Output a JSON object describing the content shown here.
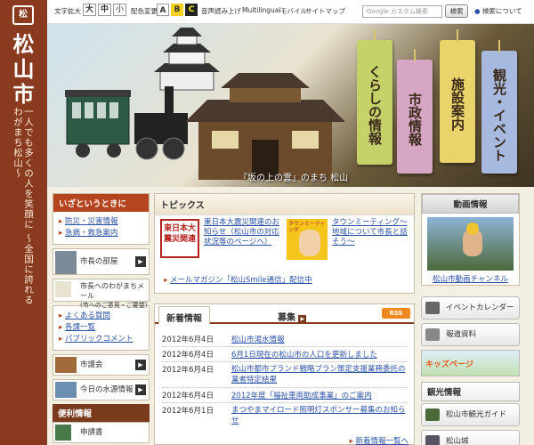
{
  "brand": {
    "logo_mark": "松",
    "city_name": "松山市",
    "slogan": "一人でも多くの人を笑顔に 〜全国に誇れるわがまち松山〜"
  },
  "topbar": {
    "text_size_label": "文字拡大",
    "size_large": "大",
    "size_medium": "中",
    "size_small": "小",
    "color_change_label": "配色変更",
    "color_a": "A",
    "color_b": "B",
    "color_c": "C",
    "speech_label": "音声読み上げ",
    "multilingual": "Multilingual",
    "mobile": "モバイル",
    "sitemap": "サイトマップ",
    "search_placeholder": "Google カスタム検索",
    "search_button": "検索",
    "search_about": "検索について"
  },
  "hero": {
    "caption": "『坂の上の雲』のまち 松山",
    "tags": [
      "くらしの情報",
      "市政情報",
      "施設案内",
      "観光・イベント"
    ],
    "tag_colors": [
      "#c5d26a",
      "#d7a6c4",
      "#e9d36b",
      "#a7b9de"
    ]
  },
  "left": {
    "emergency_header": "いざというときに",
    "emergency_links": [
      "防災・災害情報",
      "急病・救急案内"
    ],
    "mayor_room": "市長の部屋",
    "mayor_mail": "市長へのわがまちメール",
    "mayor_mail_sub": "(市へのご意見・ご要望)",
    "info_links": [
      "よくある質問",
      "各課一覧",
      "パブリックコメント"
    ],
    "assembly": "市議会",
    "water": "今日の水源情報",
    "convenience_header": "便利情報",
    "application": "申請書"
  },
  "topics": {
    "title": "トピックス",
    "banner1": "東日本大震災関連",
    "item1": "東日本大震災関連のお知らせ（松山市の対応状況等のページへ）",
    "banner2": "タウンミーティング",
    "item2": "タウンミーティング〜地域について市長と話そう〜",
    "mail_magazine": "メールマガジン「松山Smile通信」配信中"
  },
  "news": {
    "tab_new": "新着情報",
    "tab_recruit": "募集",
    "rss": "RSS",
    "items": [
      {
        "date": "2012年6月4日",
        "title": "松山市渇水情報"
      },
      {
        "date": "2012年6月4日",
        "title": "6月1日現在の松山市の人口を更新しました"
      },
      {
        "date": "2012年6月4日",
        "title": "松山市都市ブランド戦略プラン策定支援業務委託の業者特定結果"
      },
      {
        "date": "2012年6月4日",
        "title": "2012年度「福祉車両助成事業」のご案内"
      },
      {
        "date": "2012年6月1日",
        "title": "まつやまマイロード照明灯スポンサー募集のお知らせ"
      }
    ],
    "more": "新着情報一覧へ"
  },
  "right": {
    "video_header": "動画情報",
    "video_caption": "松山市動画チャンネル",
    "event_calendar": "イベントカレンダー",
    "press": "報道資料",
    "kids": "キッズページ",
    "tourism_header": "観光情報",
    "tour_guide": "松山市観光ガイド",
    "castle": "松山城"
  }
}
